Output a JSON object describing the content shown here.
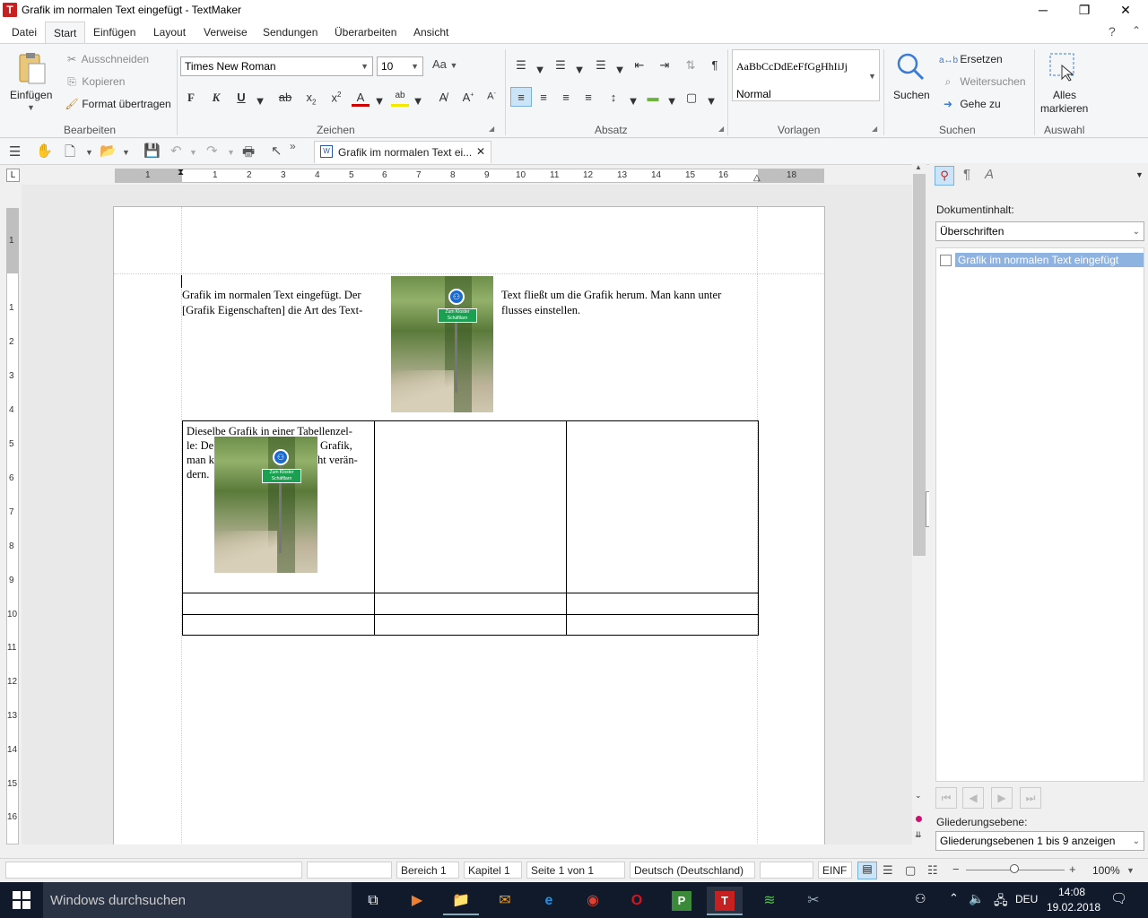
{
  "window": {
    "title": "Grafik im normalen Text eingefügt - TextMaker",
    "app_icon": "T"
  },
  "menu": [
    "Datei",
    "Start",
    "Einfügen",
    "Layout",
    "Verweise",
    "Sendungen",
    "Überarbeiten",
    "Ansicht"
  ],
  "menu_active": "Start",
  "ribbon": {
    "bearbeiten": {
      "paste": "Einfügen",
      "cut": "Ausschneiden",
      "copy": "Kopieren",
      "format_painter": "Format übertragen",
      "label": "Bearbeiten"
    },
    "zeichen": {
      "font": "Times New Roman",
      "size": "10",
      "bold": "F",
      "italic": "K",
      "underline": "U",
      "label": "Zeichen"
    },
    "absatz": {
      "label": "Absatz"
    },
    "vorlagen": {
      "preview": "AaBbCcDdEeFfGgHhIiJj",
      "style": "Normal",
      "label": "Vorlagen"
    },
    "suchen": {
      "search": "Suchen",
      "replace": "Ersetzen",
      "find_next": "Weitersuchen",
      "goto": "Gehe zu",
      "label": "Suchen"
    },
    "auswahl": {
      "select_all_1": "Alles",
      "select_all_2": "markieren",
      "label": "Auswahl"
    }
  },
  "doc_tab": "Grafik im normalen Text ei...",
  "ruler": {
    "numbers": [
      "1",
      "1",
      "2",
      "3",
      "4",
      "5",
      "6",
      "7",
      "8",
      "9",
      "10",
      "11",
      "12",
      "13",
      "14",
      "15",
      "16",
      "18"
    ],
    "vnumbers": [
      "1",
      "1",
      "2",
      "3",
      "4",
      "5",
      "6",
      "7",
      "8",
      "9",
      "10",
      "11",
      "12",
      "13",
      "14",
      "15",
      "16"
    ]
  },
  "document": {
    "para_left_1": "Grafik im normalen Text eingefügt. Der",
    "para_left_2": "[Grafik Eigenschaften] die Art des Text-",
    "para_right_1": "Text fließt um die Grafik herum. Man kann unter",
    "para_right_2": "flusses einstellen.",
    "cell_1": "Dieselbe Grafik in einer Tabellenzel-",
    "cell_2a": "le: De",
    "cell_2b": "Grafik,",
    "cell_3a": "man k",
    "cell_3b": "ht verän-",
    "cell_4": "dern.",
    "sign_text": "Zum Kloster Schäftlarn"
  },
  "sidebar": {
    "title": "Dokumentinhalt:",
    "dropdown": "Überschriften",
    "items": [
      "Grafik im normalen Text eingefügt"
    ],
    "outline_label": "Gliederungsebene:",
    "outline_value": "Gliederungsebenen 1 bis 9 anzeigen"
  },
  "status": {
    "section": "Bereich 1",
    "chapter": "Kapitel 1",
    "page": "Seite 1 von 1",
    "language": "Deutsch (Deutschland)",
    "mode": "EINF",
    "zoom": "100%"
  },
  "taskbar": {
    "search_placeholder": "Windows durchsuchen",
    "lang": "DEU",
    "time": "14:08",
    "date": "19.02.2018"
  },
  "colors": {
    "accent": "#c62020",
    "selection": "#8fb3e0",
    "taskbar": "#101a2a"
  }
}
